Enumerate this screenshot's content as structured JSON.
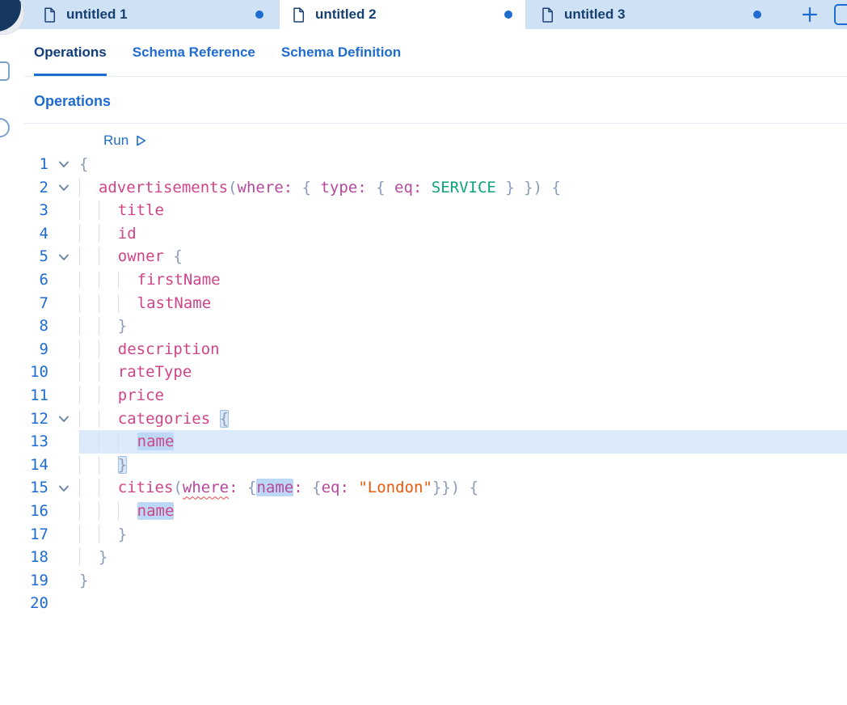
{
  "app": {
    "colors": {
      "accent_blue": "#1f6cd0",
      "tab_text": "#16406f",
      "tabbar_bg": "#cfe1f5",
      "field_pink": "#d04589",
      "argument_purple": "#b8489c",
      "enum_green": "#0aa37c",
      "punct_gray": "#8a9cba",
      "string_orange": "#e8590c",
      "current_line": "#dcebfb",
      "token_highlight": "#bcd8f4",
      "error_red": "#e5484d"
    },
    "tab_bar": {
      "tabs": [
        {
          "title": "untitled 1",
          "active": false,
          "dirty": true
        },
        {
          "title": "untitled 2",
          "active": true,
          "dirty": true
        },
        {
          "title": "untitled 3",
          "active": false,
          "dirty": true
        }
      ],
      "new_tab_label": "+"
    },
    "subtabs": [
      {
        "label": "Operations",
        "active": true
      },
      {
        "label": "Schema Reference",
        "active": false
      },
      {
        "label": "Schema Definition",
        "active": false
      }
    ],
    "section": {
      "title": "Operations"
    },
    "editor": {
      "run_label": "Run",
      "lines": [
        {
          "n": 1,
          "fold": true,
          "indent": 0,
          "tokens": [
            {
              "t": "{",
              "c": "b"
            }
          ]
        },
        {
          "n": 2,
          "fold": true,
          "indent": 2,
          "tokens": [
            {
              "t": "advertisements",
              "c": "f"
            },
            {
              "t": "(",
              "c": "b"
            },
            {
              "t": "where:",
              "c": "a"
            },
            {
              "t": " { ",
              "c": "b"
            },
            {
              "t": "type:",
              "c": "a"
            },
            {
              "t": " { ",
              "c": "b"
            },
            {
              "t": "eq:",
              "c": "a"
            },
            {
              "t": " ",
              "c": "p"
            },
            {
              "t": "SERVICE",
              "c": "e"
            },
            {
              "t": " } }) {",
              "c": "b"
            }
          ]
        },
        {
          "n": 3,
          "indent": 4,
          "tokens": [
            {
              "t": "title",
              "c": "f"
            }
          ]
        },
        {
          "n": 4,
          "indent": 4,
          "tokens": [
            {
              "t": "id",
              "c": "f"
            }
          ]
        },
        {
          "n": 5,
          "fold": true,
          "indent": 4,
          "tokens": [
            {
              "t": "owner",
              "c": "f"
            },
            {
              "t": " {",
              "c": "b"
            }
          ]
        },
        {
          "n": 6,
          "indent": 6,
          "tokens": [
            {
              "t": "firstName",
              "c": "f"
            }
          ]
        },
        {
          "n": 7,
          "indent": 6,
          "tokens": [
            {
              "t": "lastName",
              "c": "f"
            }
          ]
        },
        {
          "n": 8,
          "indent": 4,
          "tokens": [
            {
              "t": "}",
              "c": "b"
            }
          ]
        },
        {
          "n": 9,
          "indent": 4,
          "tokens": [
            {
              "t": "description",
              "c": "f"
            }
          ]
        },
        {
          "n": 10,
          "indent": 4,
          "tokens": [
            {
              "t": "rateType",
              "c": "f"
            }
          ]
        },
        {
          "n": 11,
          "indent": 4,
          "tokens": [
            {
              "t": "price",
              "c": "f"
            }
          ]
        },
        {
          "n": 12,
          "fold": true,
          "indent": 4,
          "tokens": [
            {
              "t": "categories",
              "c": "f"
            },
            {
              "t": " ",
              "c": "p"
            },
            {
              "t": "{",
              "c": "b",
              "box": true
            }
          ]
        },
        {
          "n": 13,
          "current": true,
          "indent": 6,
          "tokens": [
            {
              "t": "name",
              "c": "f",
              "hl": true
            }
          ]
        },
        {
          "n": 14,
          "indent": 4,
          "tokens": [
            {
              "t": "}",
              "c": "b",
              "box": true
            }
          ]
        },
        {
          "n": 15,
          "fold": true,
          "indent": 4,
          "tokens": [
            {
              "t": "cities",
              "c": "f"
            },
            {
              "t": "(",
              "c": "b"
            },
            {
              "t": "where",
              "c": "a",
              "sq": true
            },
            {
              "t": ":",
              "c": "a"
            },
            {
              "t": " ",
              "c": "p"
            },
            {
              "t": "{",
              "c": "b"
            },
            {
              "t": "name",
              "c": "a",
              "hl": true
            },
            {
              "t": ":",
              "c": "a"
            },
            {
              "t": " ",
              "c": "p"
            },
            {
              "t": "{",
              "c": "b"
            },
            {
              "t": "eq:",
              "c": "a"
            },
            {
              "t": " ",
              "c": "p"
            },
            {
              "t": "\"London\"",
              "c": "s"
            },
            {
              "t": "}}) {",
              "c": "b"
            }
          ]
        },
        {
          "n": 16,
          "indent": 6,
          "tokens": [
            {
              "t": "name",
              "c": "f",
              "hl": true
            }
          ]
        },
        {
          "n": 17,
          "indent": 4,
          "tokens": [
            {
              "t": "}",
              "c": "b"
            }
          ]
        },
        {
          "n": 18,
          "indent": 2,
          "tokens": [
            {
              "t": "}",
              "c": "b"
            }
          ]
        },
        {
          "n": 19,
          "indent": 0,
          "tokens": [
            {
              "t": "}",
              "c": "b"
            }
          ]
        },
        {
          "n": 20,
          "indent": 0,
          "tokens": []
        }
      ]
    }
  }
}
